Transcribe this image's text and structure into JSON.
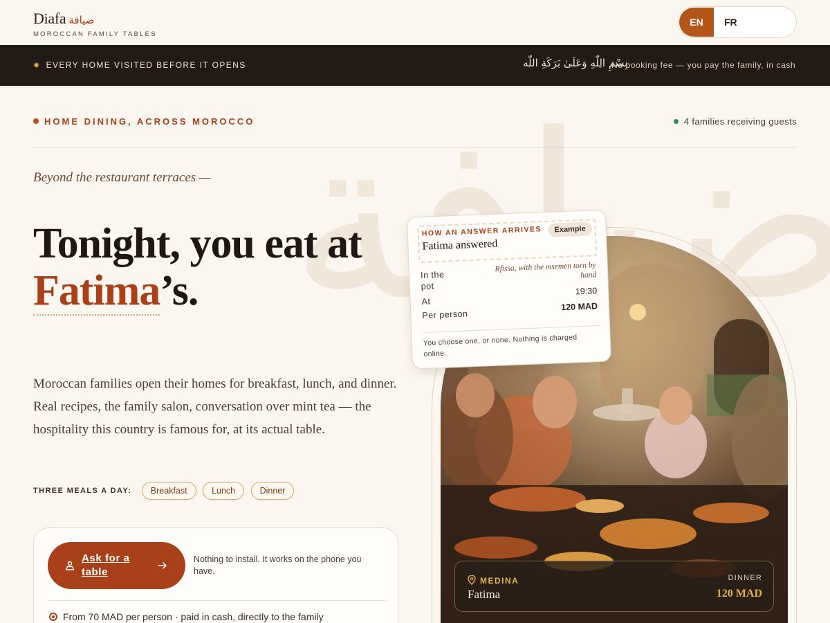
{
  "header": {
    "brand_name": "Diafa",
    "brand_arabic": "ضيافة",
    "tagline": "MOROCCAN FAMILY TABLES",
    "lang_options": [
      "EN",
      "FR"
    ],
    "lang_selected": "EN"
  },
  "banner": {
    "left_text": "EVERY HOME VISITED BEFORE IT OPENS",
    "arabic_blessing": "بِسْمِ اللّٰهِ وَعَلَىٰ بَرَكَةِ اللّٰه",
    "right_text": "No booking fee — you pay the family, in cash"
  },
  "watermark": "ضيافة",
  "hero": {
    "eyebrow": "HOME DINING, ACROSS MOROCCO",
    "families_status": "4 families receiving guests",
    "kicker": "Beyond the restaurant terraces —",
    "headline_line1": "Tonight, you eat at",
    "headline_name": "Fatima",
    "headline_suffix": "’s.",
    "lead": "Moroccan families open their homes for breakfast, lunch, and dinner. Real recipes, the family salon, conversation over mint tea — the hospitality this country is famous for, at its actual table.",
    "meals_label": "THREE MEALS A DAY:",
    "meals": [
      "Breakfast",
      "Lunch",
      "Dinner"
    ]
  },
  "cta": {
    "button_label": "Ask for a table",
    "note": "Nothing to install. It works on the phone you have.",
    "price_line": "From 70 MAD per person · paid in cash, directly to the family"
  },
  "answer_card": {
    "eyebrow": "HOW AN ANSWER ARRIVES",
    "title": "Fatima answered",
    "badge": "Example",
    "rows": [
      {
        "label": "In the pot",
        "value": "Rfissa, with the msemen torn by hand"
      },
      {
        "label": "At",
        "value": "19:30"
      },
      {
        "label": "Per person",
        "value": "120 MAD"
      }
    ],
    "footer": "You choose one, or none. Nothing is charged online."
  },
  "photo_badge": {
    "location": "MEDINA",
    "host": "Fatima",
    "meal": "DINNER",
    "price": "120 MAD"
  },
  "colors": {
    "accent": "#a8401a",
    "background": "#fbf6ef",
    "banner": "#221a15",
    "gold": "#e3b04a",
    "status_green": "#2f8a52"
  },
  "icons": {
    "banner_star": "star-icon",
    "cta_person": "person-icon",
    "cta_arrow": "arrow-right-icon",
    "price_pin": "location-pin-icon",
    "badge_pin": "location-pin-icon"
  }
}
